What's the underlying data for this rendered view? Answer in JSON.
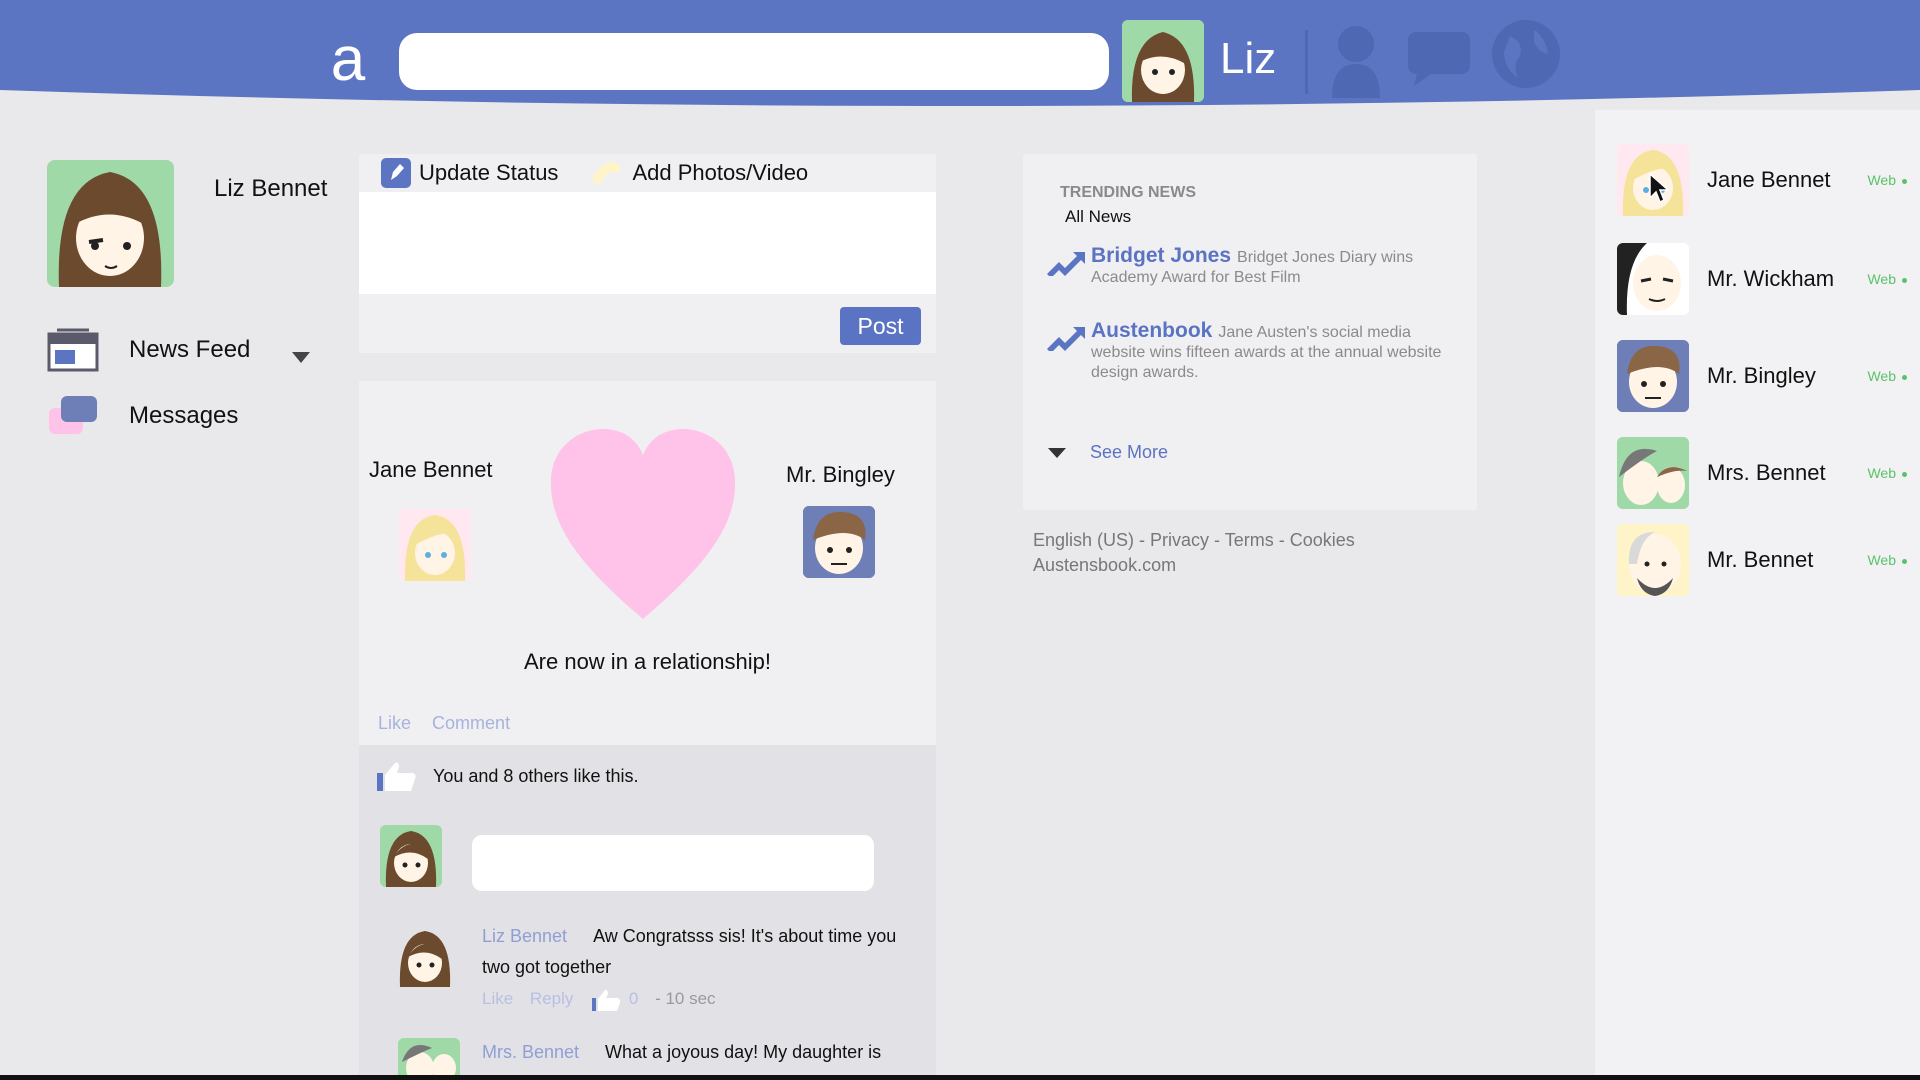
{
  "header": {
    "logo_letter": "a",
    "search_placeholder": "",
    "user_name": "Liz",
    "icons": [
      "friends-icon",
      "messages-icon",
      "notifications-globe-icon"
    ]
  },
  "profile": {
    "name": "Liz Bennet"
  },
  "nav": {
    "items": [
      {
        "label": "News Feed",
        "icon": "news-feed-icon"
      },
      {
        "label": "Messages",
        "icon": "messages-icon"
      }
    ]
  },
  "composer": {
    "tabs": [
      {
        "label": "Update Status",
        "icon": "pencil-icon"
      },
      {
        "label": "Add Photos/Video",
        "icon": "photo-icon"
      }
    ],
    "post_label": "Post"
  },
  "story": {
    "left_name": "Jane Bennet",
    "right_name": "Mr. Bingley",
    "text": "Are now in a relationship!",
    "like_label": "Like",
    "comment_label": "Comment",
    "likes_text": "You and 8 others like this.",
    "comments": [
      {
        "author": "Liz Bennet",
        "text": "Aw Congratsss sis! It's about time you two got together",
        "like": "Like",
        "reply": "Reply",
        "likes": "0",
        "time": "- 10 sec"
      },
      {
        "author": "Mrs. Bennet",
        "text": "What a joyous day! My daughter is"
      }
    ]
  },
  "trending": {
    "heading": "TRENDING NEWS",
    "subheading": "All News",
    "items": [
      {
        "title": "Bridget Jones",
        "text": "Bridget Jones Diary wins Academy Award for Best Film"
      },
      {
        "title": "Austenbook",
        "text": "Jane Austen's social media website wins fifteen awards at the annual website design awards."
      }
    ],
    "see_more": "See More"
  },
  "footer": {
    "links": "English (US) - Privacy - Terms - Cookies",
    "site": "Austensbook.com"
  },
  "friends": [
    {
      "name": "Jane Bennet",
      "status": "Web"
    },
    {
      "name": "Mr. Wickham",
      "status": "Web"
    },
    {
      "name": "Mr. Bingley",
      "status": "Web"
    },
    {
      "name": "Mrs. Bennet",
      "status": "Web"
    },
    {
      "name": "Mr. Bennet",
      "status": "Web"
    }
  ],
  "colors": {
    "header_blue": "#5b75c3",
    "accent_blue": "#5a73c2",
    "online_green": "#5ac26a",
    "heart_pink": "#ffc2e8"
  }
}
